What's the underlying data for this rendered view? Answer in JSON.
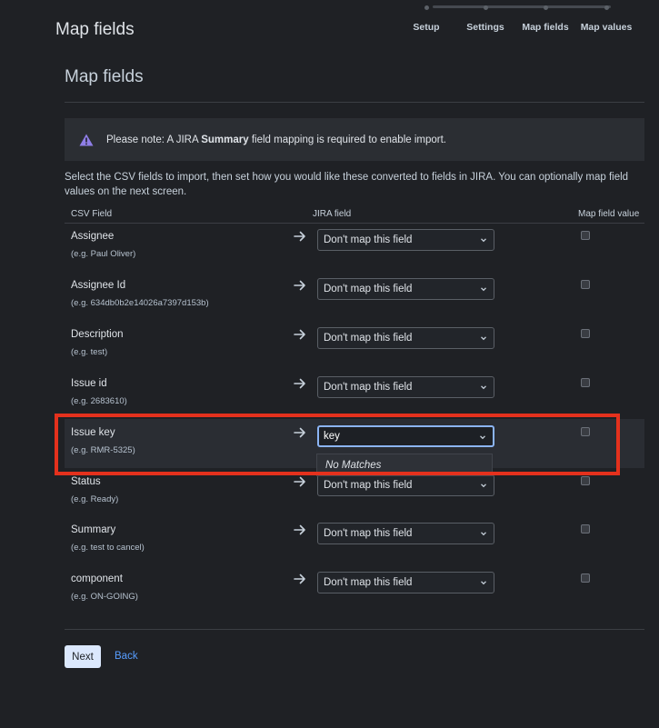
{
  "header": {
    "title": "Map fields",
    "steps": [
      "Setup",
      "Settings",
      "Map fields",
      "Map values"
    ]
  },
  "section": {
    "title": "Map fields"
  },
  "notice": {
    "icon": "warning-icon",
    "prefix": "Please note: A JIRA ",
    "emphasis": "Summary",
    "suffix": " field mapping is required to enable import."
  },
  "intro": "Select the CSV fields to import, then set how you would like these converted to fields in JIRA. You can optionally map field values on the next screen.",
  "table": {
    "columns": [
      "CSV Field",
      "JIRA field",
      "Map field value"
    ],
    "rows": [
      {
        "name": "Assignee",
        "example": "(e.g. Paul Oliver)",
        "mapping": "Don't map this field",
        "map_value": false
      },
      {
        "name": "Assignee Id",
        "example": "(e.g. 634db0b2e14026a7397d153b)",
        "mapping": "Don't map this field",
        "map_value": false
      },
      {
        "name": "Description",
        "example": "(e.g. test)",
        "mapping": "Don't map this field",
        "map_value": false
      },
      {
        "name": "Issue id",
        "example": "(e.g. 2683610)",
        "mapping": "Don't map this field",
        "map_value": false
      },
      {
        "name": "Issue key",
        "example": "(e.g. RMR-5325)",
        "mapping": "key",
        "map_value": false
      },
      {
        "name": "Status",
        "example": "(e.g. Ready)",
        "mapping": "Don't map this field",
        "map_value": false
      },
      {
        "name": "Summary",
        "example": "(e.g. test to cancel)",
        "mapping": "Don't map this field",
        "map_value": false
      },
      {
        "name": "component",
        "example": "(e.g. ON-GOING)",
        "mapping": "Don't map this field",
        "map_value": false
      }
    ]
  },
  "dropdown": {
    "message": "No Matches"
  },
  "actions": {
    "next_label": "Next",
    "back_label": "Back"
  },
  "colors": {
    "background": "#1f2125",
    "accent": "#579dff",
    "highlight": "#e4311d",
    "warning": "#8f7ee7"
  }
}
